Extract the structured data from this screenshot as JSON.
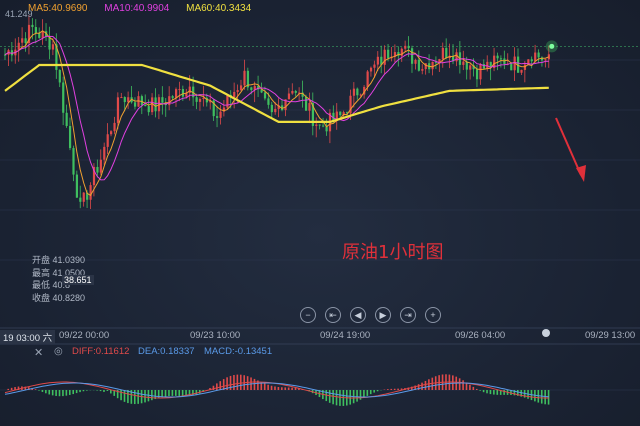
{
  "ma_legend": {
    "ma5": "MA5:40.9690",
    "ma10": "MA10:40.9904",
    "ma60": "MA60:40.3434"
  },
  "high_label": "41.249",
  "ohlc": {
    "open": "开盘 41.0390",
    "high": "最高 41.0500",
    "low": "最低 40.8",
    "close": "收盘 40.8280"
  },
  "low_label": "38.651",
  "title": "原油1小时图",
  "controls": {
    "zoom_out": "−",
    "prev": "⇤",
    "back": "◀",
    "forward": "▶",
    "next": "⇥",
    "zoom_in": "+"
  },
  "x_axis": {
    "first": "19 03:00 六",
    "t1": "09/22 00:00",
    "t2": "09/23 10:00",
    "t3": "09/24 19:00",
    "t4": "09/26 04:00",
    "t5": "09/29 13:00"
  },
  "macd_legend": {
    "diff": "DIFF:0.11612",
    "dea": "DEA:0.18337",
    "macd": "MACD:-0.13451"
  },
  "icons": {
    "close": "close-icon",
    "eye": "eye-icon"
  },
  "colors": {
    "up": "#e04a4a",
    "down": "#3fbf5f",
    "ma5": "#f0a030",
    "ma10": "#e040e0",
    "ma60": "#f0e040",
    "diff": "#e04a4a",
    "dea": "#5a9ae8",
    "annotation": "#e0303a"
  },
  "chart_data": {
    "type": "candlestick",
    "series": [
      {
        "name": "MA5",
        "values": []
      },
      {
        "name": "MA10",
        "values": []
      },
      {
        "name": "MA60",
        "values": []
      }
    ],
    "ma_values": {
      "MA5": 40.969,
      "MA10": 40.9904,
      "MA60": 40.3434
    },
    "y_marks": {
      "high": 41.249,
      "low": 38.651
    },
    "last_candle": {
      "open": 41.039,
      "high": 41.05,
      "close": 40.828
    },
    "x_ticks": [
      "09/22 00:00",
      "09/23 10:00",
      "09/24 19:00",
      "09/26 04:00",
      "09/29 13:00"
    ],
    "macd": {
      "diff": 0.11612,
      "dea": 0.18337,
      "macd": -0.13451
    }
  }
}
